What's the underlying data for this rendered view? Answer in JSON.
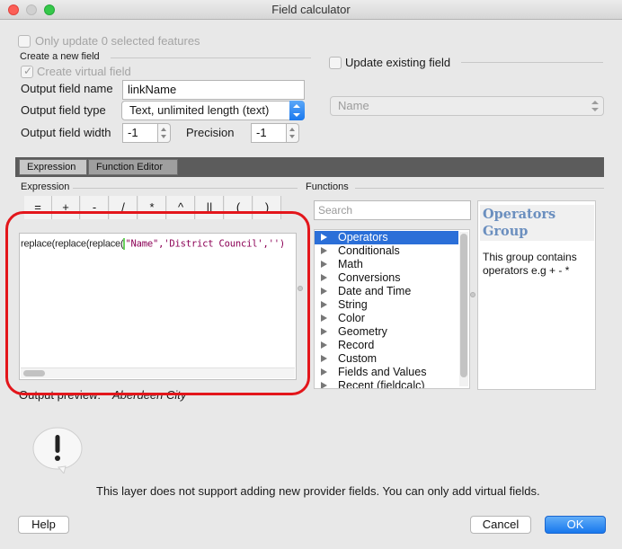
{
  "window": {
    "title": "Field calculator"
  },
  "only_update": {
    "label": "Only update 0 selected features",
    "checked": false
  },
  "create_field": {
    "group_label": "Create a new field",
    "virtual_label": "Create virtual field",
    "virtual_checked": true,
    "output_name_label": "Output field name",
    "output_name_value": "linkName",
    "output_type_label": "Output field type",
    "output_type_value": "Text, unlimited length (text)",
    "output_width_label": "Output field width",
    "output_width_value": "-1",
    "precision_label": "Precision",
    "precision_value": "-1"
  },
  "update_field": {
    "label": "Update existing field",
    "checked": false,
    "select_value": "Name"
  },
  "tabs": [
    {
      "label": "Expression",
      "active": true
    },
    {
      "label": "Function Editor",
      "active": false
    }
  ],
  "expression": {
    "group_label": "Expression",
    "operators": [
      "=",
      "+",
      "-",
      "/",
      "*",
      "^",
      "||",
      "(",
      ")"
    ],
    "text_kw": "replace(replace(replace(",
    "text_str": "\"Name\",'District Council','')",
    "preview_label": "Output preview:",
    "preview_value": "Aberdeen City"
  },
  "functions": {
    "group_label": "Functions",
    "search_placeholder": "Search",
    "items": [
      "Operators",
      "Conditionals",
      "Math",
      "Conversions",
      "Date and Time",
      "String",
      "Color",
      "Geometry",
      "Record",
      "Custom",
      "Fields and Values",
      "Recent (fieldcalc)"
    ],
    "selected_index": 0
  },
  "help": {
    "title": "Operators Group",
    "text": "This group contains operators e.g + - *"
  },
  "notice": {
    "text": "This layer does not support adding new provider fields. You can only add virtual fields.",
    "icon": "exclamation-bubble-icon"
  },
  "buttons": {
    "help": "Help",
    "cancel": "Cancel",
    "ok": "OK"
  },
  "colors": {
    "accent": "#2b6fd8",
    "highlight": "#e3161b",
    "tabbar": "#5c5c5c"
  }
}
